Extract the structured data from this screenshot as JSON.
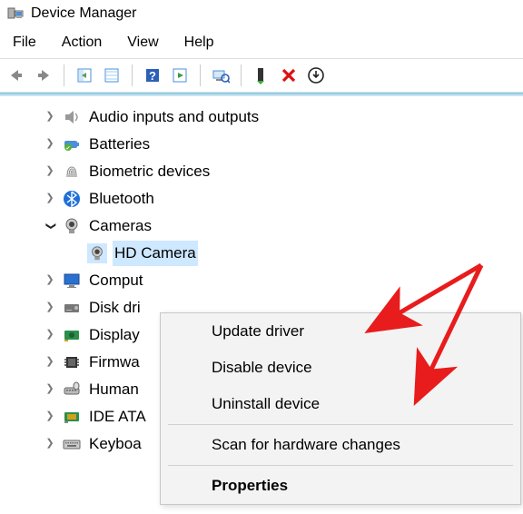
{
  "window": {
    "title": "Device Manager"
  },
  "menubar": {
    "file": "File",
    "action": "Action",
    "view": "View",
    "help": "Help"
  },
  "tree": {
    "items": [
      {
        "label": "Audio inputs and outputs",
        "expanded": false
      },
      {
        "label": "Batteries",
        "expanded": false
      },
      {
        "label": "Biometric devices",
        "expanded": false
      },
      {
        "label": "Bluetooth",
        "expanded": false
      },
      {
        "label": "Cameras",
        "expanded": true
      },
      {
        "label": "Computers",
        "expanded": false,
        "truncated": "Comput"
      },
      {
        "label": "Disk drives",
        "expanded": false,
        "truncated": "Disk dri"
      },
      {
        "label": "Display adapters",
        "expanded": false,
        "truncated": "Display"
      },
      {
        "label": "Firmware",
        "expanded": false,
        "truncated": "Firmwa"
      },
      {
        "label": "Human Interface Devices",
        "expanded": false,
        "truncated": "Human"
      },
      {
        "label": "IDE ATA/ATAPI controllers",
        "expanded": false,
        "truncated": "IDE ATA"
      },
      {
        "label": "Keyboards",
        "expanded": false,
        "truncated": "Keyboa"
      }
    ],
    "child": {
      "label": "HD Camera",
      "selected": true
    }
  },
  "context_menu": {
    "update": "Update driver",
    "disable": "Disable device",
    "uninstall": "Uninstall device",
    "scan": "Scan for hardware changes",
    "properties": "Properties"
  }
}
